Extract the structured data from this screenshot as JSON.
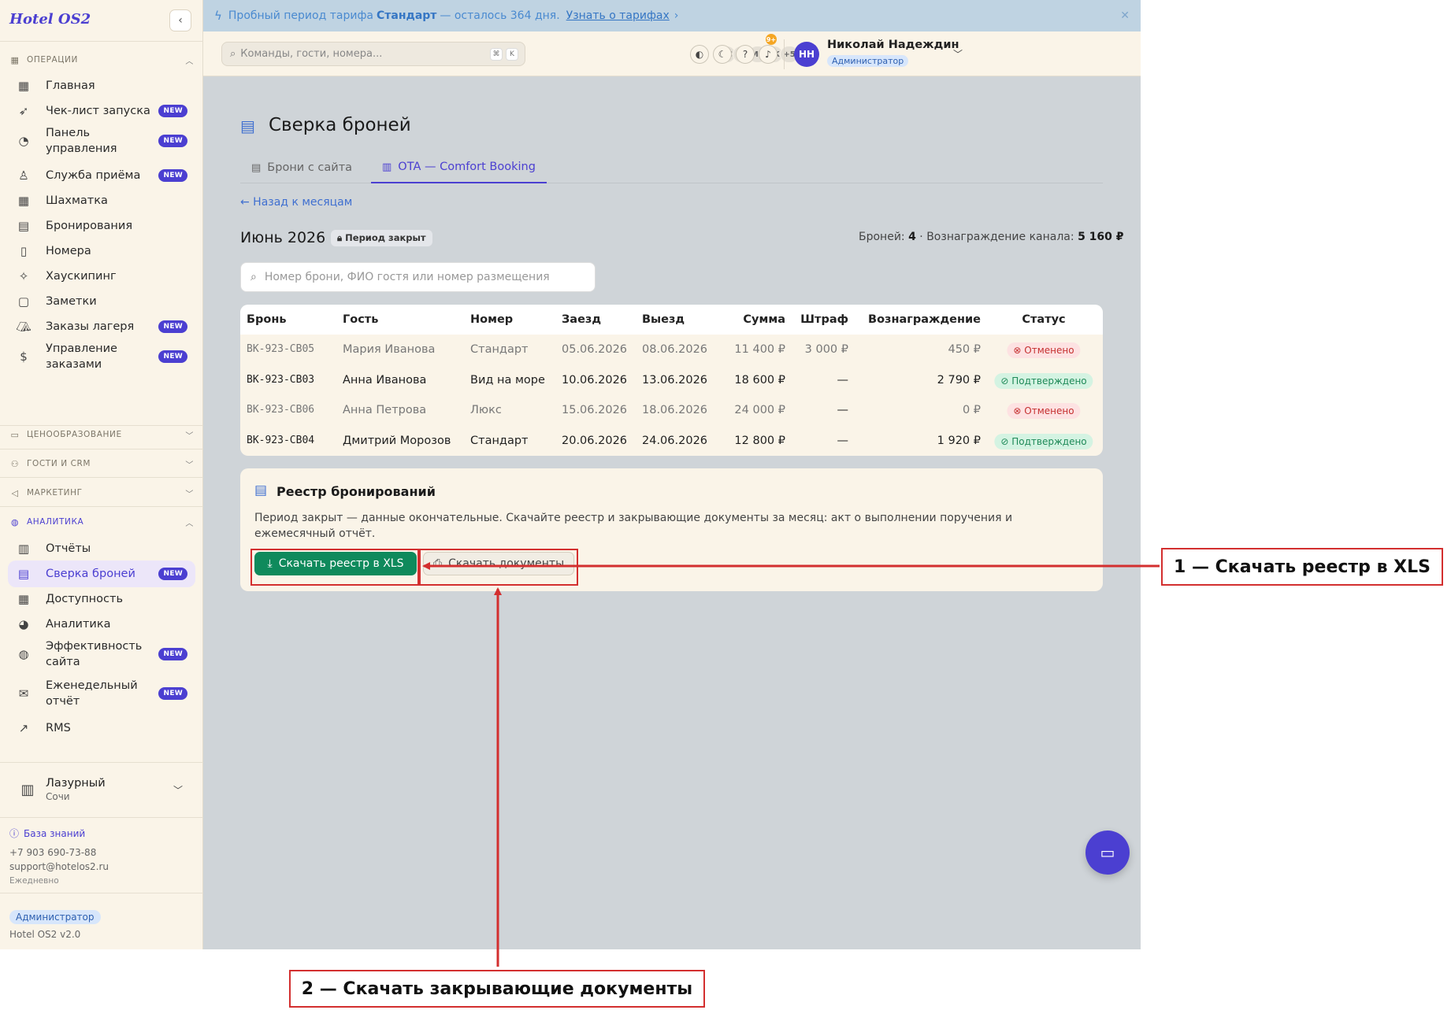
{
  "app": {
    "logo": "Hotel OS2"
  },
  "banner": {
    "prefix": "Пробный период тарифа",
    "plan": "Стандарт",
    "suffix": "— осталось 364 дня.",
    "link": "Узнать о тарифах"
  },
  "topbar": {
    "search_placeholder": "Команды, гости, номера...",
    "shortcut": [
      "⌘",
      "K"
    ],
    "presence": [
      "ИС",
      "ОС",
      "МИ",
      "АК",
      "+5"
    ],
    "notif_count": "9+",
    "user": {
      "initials": "НН",
      "name": "Николай Надеждин",
      "role": "Администратор"
    }
  },
  "sidebar": {
    "sections": {
      "operations": "Операции",
      "pricing": "Ценообразование",
      "guests": "Гости и CRM",
      "marketing": "Маркетинг",
      "analytics": "Аналитика"
    },
    "new_badge": "NEW",
    "ops_items": [
      {
        "label": "Главная",
        "icon": "grid-icon",
        "new": false
      },
      {
        "label": "Чек-лист запуска",
        "icon": "rocket-icon",
        "new": true
      },
      {
        "label": "Панель управления",
        "icon": "gauge-icon",
        "new": true
      },
      {
        "label": "Служба приёма",
        "icon": "bell-icon",
        "new": true
      },
      {
        "label": "Шахматка",
        "icon": "table-icon",
        "new": false
      },
      {
        "label": "Бронирования",
        "icon": "clipboard-icon",
        "new": false
      },
      {
        "label": "Номера",
        "icon": "door-icon",
        "new": false
      },
      {
        "label": "Хаускипинг",
        "icon": "sparkles-icon",
        "new": false
      },
      {
        "label": "Заметки",
        "icon": "note-icon",
        "new": false
      },
      {
        "label": "Заказы лагеря",
        "icon": "tent-icon",
        "new": true
      },
      {
        "label": "Управление заказами",
        "icon": "receipt-icon",
        "new": true
      }
    ],
    "analytics_items": [
      {
        "label": "Отчёты",
        "icon": "bar-chart-icon",
        "new": false
      },
      {
        "label": "Сверка броней",
        "icon": "document-icon",
        "new": true,
        "active": true
      },
      {
        "label": "Доступность",
        "icon": "table-icon",
        "new": false
      },
      {
        "label": "Аналитика",
        "icon": "pie-icon",
        "new": false
      },
      {
        "label": "Эффективность сайта",
        "icon": "globe-icon",
        "new": true
      },
      {
        "label": "Еженедельный отчёт",
        "icon": "mail-icon",
        "new": true
      },
      {
        "label": "RMS",
        "icon": "trend-icon",
        "new": false
      }
    ],
    "hotel": {
      "name": "Лазурный",
      "city": "Сочи"
    },
    "support": {
      "kb": "База знаний",
      "phone": "+7 903 690-73-88",
      "email": "support@hotelos2.ru",
      "hours": "Ежедневно"
    },
    "role": "Администратор",
    "version": "Hotel OS2 v2.0"
  },
  "page": {
    "title": "Сверка броней",
    "tabs": [
      "Брони с сайта",
      "OTA — Comfort Booking"
    ],
    "back": "← Назад к месяцам",
    "month": "Июнь 2026",
    "closed_badge": "Период закрыт",
    "summary": {
      "bookings_label": "Броней:",
      "bookings": "4",
      "sep": "·",
      "reward_label": "Вознаграждение канала:",
      "reward": "5 160 ₽"
    },
    "search_placeholder": "Номер брони, ФИО гостя или номер размещения"
  },
  "table": {
    "headers": [
      "Бронь",
      "Гость",
      "Номер",
      "Заезд",
      "Выезд",
      "Сумма",
      "Штраф",
      "Вознаграждение",
      "Статус"
    ],
    "rows": [
      [
        "BK-923-CB05",
        "Мария Иванова",
        "Стандарт",
        "05.06.2026",
        "08.06.2026",
        "11 400 ₽",
        "3 000 ₽",
        "450 ₽",
        "Отменено"
      ],
      [
        "BK-923-CB03",
        "Анна Иванова",
        "Вид на море",
        "10.06.2026",
        "13.06.2026",
        "18 600 ₽",
        "—",
        "2 790 ₽",
        "Подтверждено"
      ],
      [
        "BK-923-CB06",
        "Анна Петрова",
        "Люкс",
        "15.06.2026",
        "18.06.2026",
        "24 000 ₽",
        "—",
        "0 ₽",
        "Отменено"
      ],
      [
        "BK-923-CB04",
        "Дмитрий Морозов",
        "Стандарт",
        "20.06.2026",
        "24.06.2026",
        "12 800 ₽",
        "—",
        "1 920 ₽",
        "Подтверждено"
      ]
    ]
  },
  "registry": {
    "title": "Реестр бронирований",
    "desc": "Период закрыт — данные окончательные. Скачайте реестр и закрывающие документы за месяц: акт о выполнении поручения и ежемесячный отчёт.",
    "btn_xls": "Скачать реестр в XLS",
    "btn_docs": "Скачать документы"
  },
  "annotations": {
    "one": "1 — Скачать реестр в XLS",
    "two": "2 — Скачать закрывающие документы",
    "color": "#d32f2f"
  }
}
